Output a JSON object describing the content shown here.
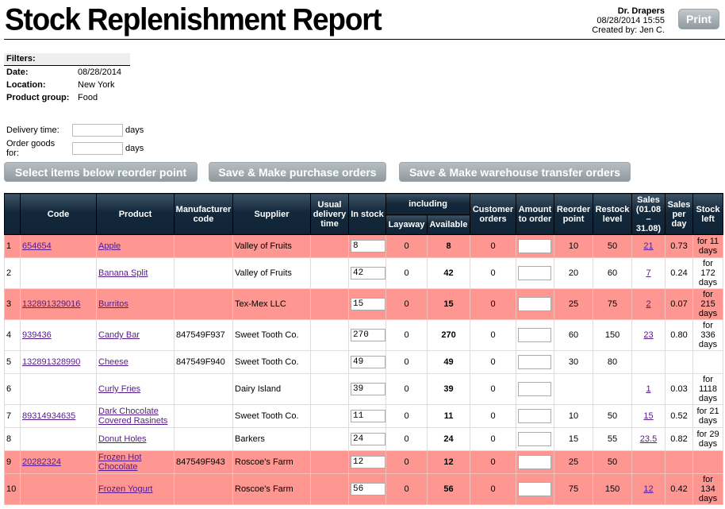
{
  "header": {
    "title": "Stock Replenishment Report",
    "company": "Dr. Drapers",
    "datetime": "08/28/2014 15:55",
    "created_by": "Created by: Jen C.",
    "print_label": "Print"
  },
  "filters": {
    "heading": "Filters:",
    "items": [
      {
        "label": "Date:",
        "value": "08/28/2014"
      },
      {
        "label": "Location:",
        "value": "New York"
      },
      {
        "label": "Product group:",
        "value": "Food"
      }
    ]
  },
  "options": {
    "delivery_label": "Delivery time:",
    "delivery_value": "",
    "order_label": "Order goods for:",
    "order_value": "",
    "unit": "days"
  },
  "actions": {
    "select_below": "Select items below reorder point",
    "purchase": "Save & Make purchase orders",
    "transfer": "Save & Make warehouse transfer orders"
  },
  "table": {
    "headers": {
      "code": "Code",
      "product": "Product",
      "mfr": "Manufacturer code",
      "supplier": "Supplier",
      "delivery": "Usual delivery time",
      "in_stock": "In stock",
      "including": "including",
      "layaway": "Layaway",
      "available": "Available",
      "customer_orders": "Customer orders",
      "amount": "Amount to order",
      "reorder": "Reorder point",
      "restock": "Restock level",
      "sales": "Sales (01.08 – 31.08)",
      "sales_per_day": "Sales per day",
      "stock_left": "Stock left"
    },
    "rows": [
      {
        "n": "1",
        "code": "654654",
        "product": "Apple",
        "mfr": "",
        "supplier": "Valley of Fruits",
        "delivery": "",
        "in_stock": "8",
        "layaway": "0",
        "available": "8",
        "cust": "0",
        "amount": "",
        "reorder": "10",
        "restock": "50",
        "sales": "21",
        "spd": "0.73",
        "left": "for 11 days",
        "low": true
      },
      {
        "n": "2",
        "code": "",
        "product": "Banana Split",
        "mfr": "",
        "supplier": "Valley of Fruits",
        "delivery": "",
        "in_stock": "42",
        "layaway": "0",
        "available": "42",
        "cust": "0",
        "amount": "",
        "reorder": "20",
        "restock": "60",
        "sales": "7",
        "spd": "0.24",
        "left": "for 172 days",
        "low": false
      },
      {
        "n": "3",
        "code": "132891329016",
        "product": "Burritos",
        "mfr": "",
        "supplier": "Tex-Mex LLC",
        "delivery": "",
        "in_stock": "15",
        "layaway": "0",
        "available": "15",
        "cust": "0",
        "amount": "",
        "reorder": "25",
        "restock": "75",
        "sales": "2",
        "spd": "0.07",
        "left": "for 215 days",
        "low": true
      },
      {
        "n": "4",
        "code": "939436",
        "product": "Candy Bar",
        "mfr": "847549F937",
        "supplier": "Sweet Tooth Co.",
        "delivery": "",
        "in_stock": "270",
        "layaway": "0",
        "available": "270",
        "cust": "0",
        "amount": "",
        "reorder": "60",
        "restock": "150",
        "sales": "23",
        "spd": "0.80",
        "left": "for 336 days",
        "low": false
      },
      {
        "n": "5",
        "code": "132891328990",
        "product": "Cheese",
        "mfr": "847549F940",
        "supplier": "Sweet Tooth Co.",
        "delivery": "",
        "in_stock": "49",
        "layaway": "0",
        "available": "49",
        "cust": "0",
        "amount": "",
        "reorder": "30",
        "restock": "80",
        "sales": "",
        "spd": "",
        "left": "",
        "low": false
      },
      {
        "n": "6",
        "code": "",
        "product": "Curly Fries",
        "mfr": "",
        "supplier": "Dairy Island",
        "delivery": "",
        "in_stock": "39",
        "layaway": "0",
        "available": "39",
        "cust": "0",
        "amount": "",
        "reorder": "",
        "restock": "",
        "sales": "1",
        "spd": "0.03",
        "left": "for 1118 days",
        "low": false
      },
      {
        "n": "7",
        "code": "89314934635",
        "product": "Dark Chocolate Covered Rasinets",
        "mfr": "",
        "supplier": "Sweet Tooth Co.",
        "delivery": "",
        "in_stock": "11",
        "layaway": "0",
        "available": "11",
        "cust": "0",
        "amount": "",
        "reorder": "10",
        "restock": "50",
        "sales": "15",
        "spd": "0.52",
        "left": "for 21 days",
        "low": false
      },
      {
        "n": "8",
        "code": "",
        "product": "Donut Holes",
        "mfr": "",
        "supplier": "Barkers",
        "delivery": "",
        "in_stock": "24",
        "layaway": "0",
        "available": "24",
        "cust": "0",
        "amount": "",
        "reorder": "15",
        "restock": "55",
        "sales": "23.5",
        "spd": "0.82",
        "left": "for 29 days",
        "low": false
      },
      {
        "n": "9",
        "code": "20282324",
        "product": "Frozen Hot Chocolate",
        "mfr": "847549F943",
        "supplier": "Roscoe's Farm",
        "delivery": "",
        "in_stock": "12",
        "layaway": "0",
        "available": "12",
        "cust": "0",
        "amount": "",
        "reorder": "25",
        "restock": "50",
        "sales": "",
        "spd": "",
        "left": "",
        "low": true
      },
      {
        "n": "10",
        "code": "",
        "product": "Frozen Yogurt",
        "mfr": "",
        "supplier": "Roscoe's Farm",
        "delivery": "",
        "in_stock": "56",
        "layaway": "0",
        "available": "56",
        "cust": "0",
        "amount": "",
        "reorder": "75",
        "restock": "150",
        "sales": "12",
        "spd": "0.42",
        "left": "for 134 days",
        "low": true
      }
    ]
  },
  "colors": {
    "low_stock_row": "#fe9791",
    "header_bg": "#13283b",
    "link": "#551a8b"
  }
}
